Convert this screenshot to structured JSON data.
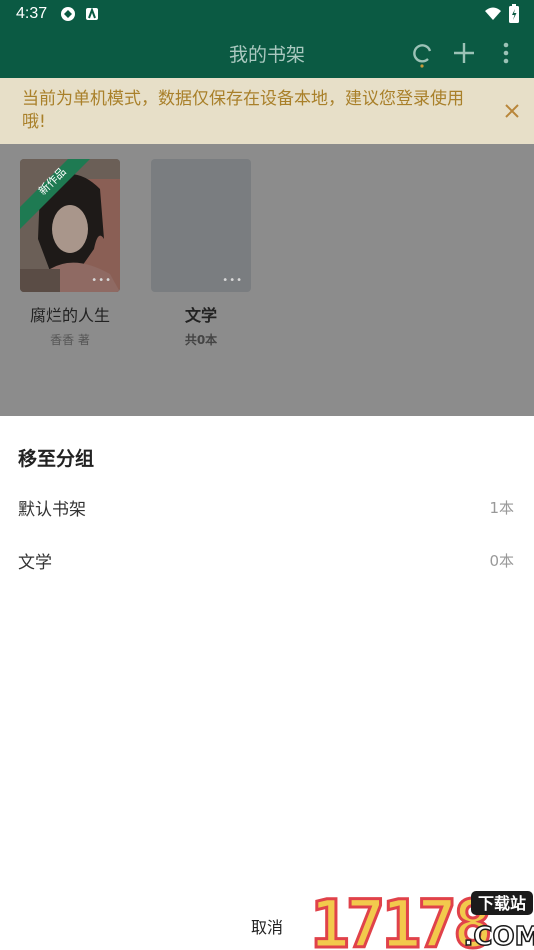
{
  "status": {
    "time": "4:37"
  },
  "appbar": {
    "title": "我的书架"
  },
  "notice": {
    "text": "当前为单机模式，数据仅保存在设备本地，建议您登录使用哦!"
  },
  "books": [
    {
      "name": "腐烂的人生",
      "sub": "香香 著",
      "badge": "新作品"
    },
    {
      "name": "文学",
      "sub": "共0本"
    }
  ],
  "sheet": {
    "heading": "移至分组",
    "groups": [
      {
        "name": "默认书架",
        "count": "1本"
      },
      {
        "name": "文学",
        "count": "0本"
      }
    ],
    "cancel": "取消"
  },
  "watermark": {
    "digits": "17178",
    "tag": "下载站",
    "domain": ".COM"
  },
  "colors": {
    "bar": "#0b5a43",
    "notice_text": "#a9802a",
    "badge": "#1f8a5a"
  }
}
